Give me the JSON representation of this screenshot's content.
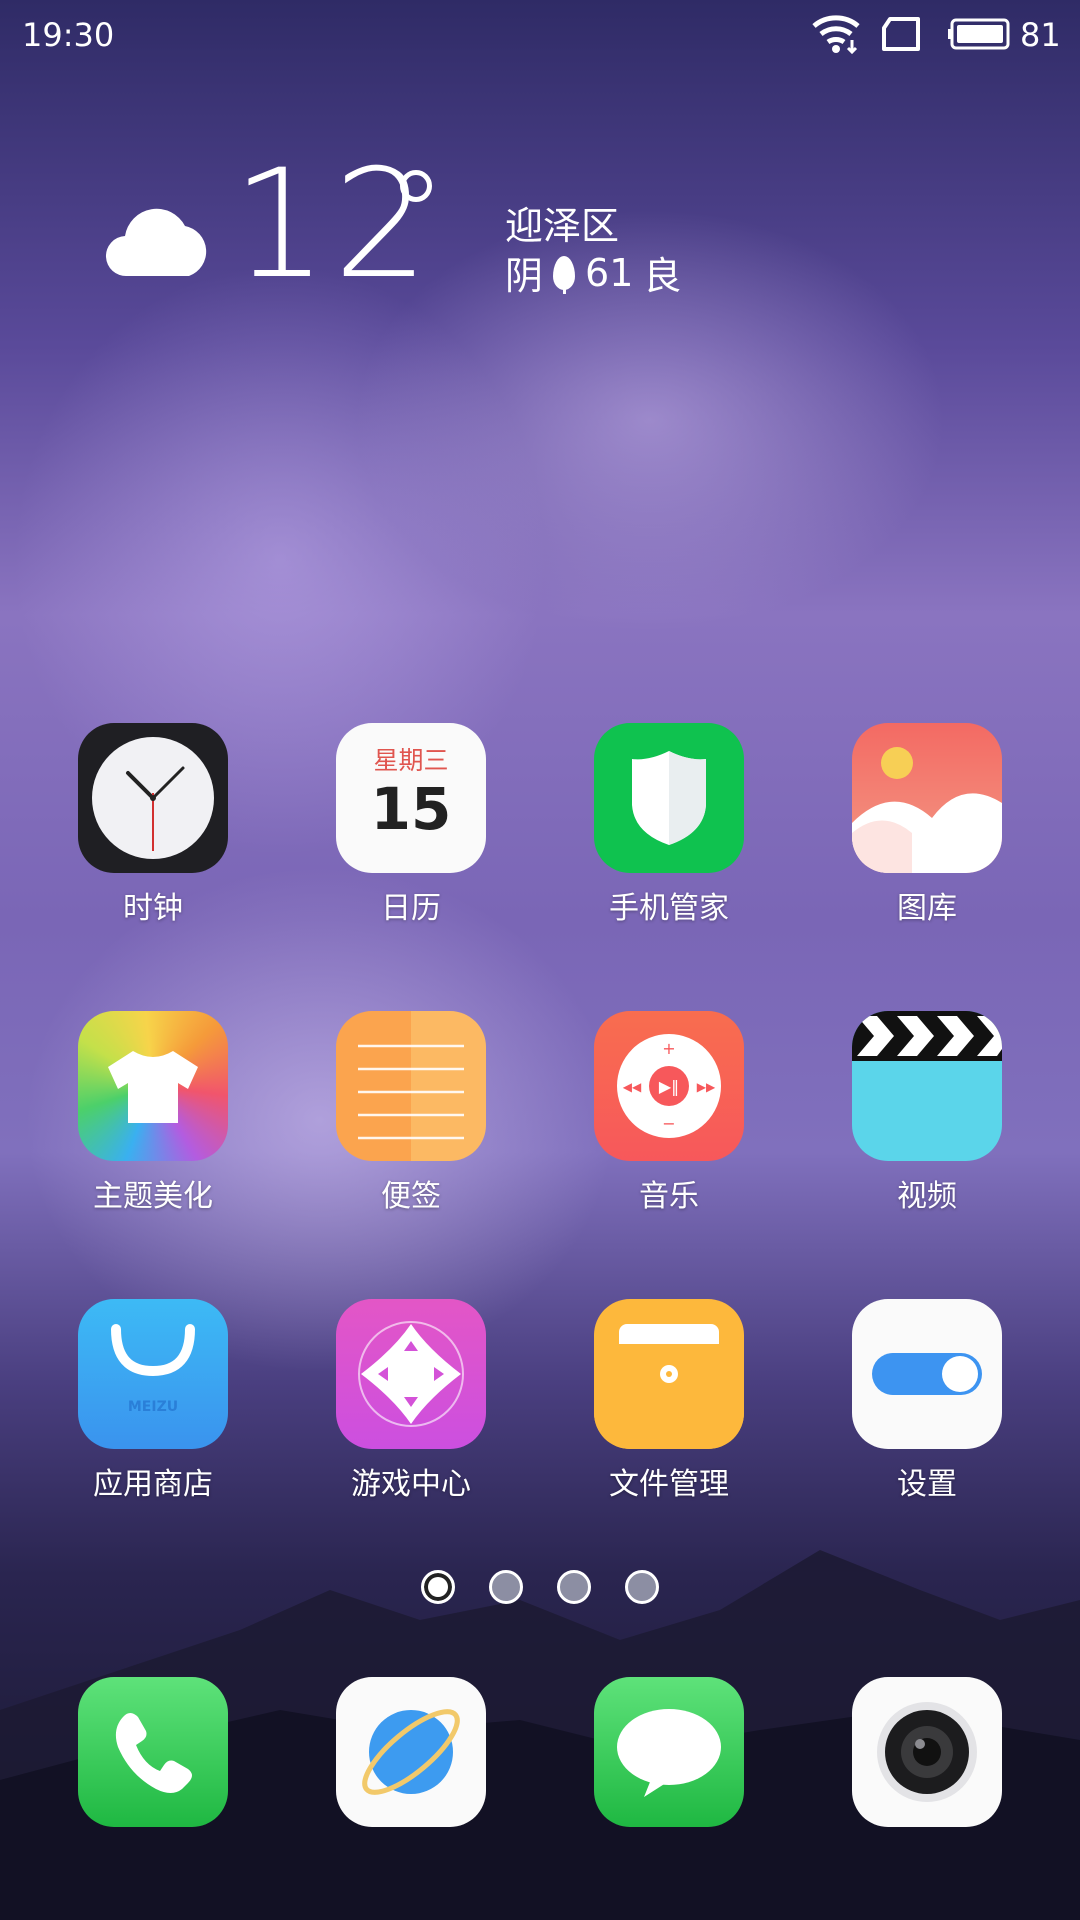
{
  "status_bar": {
    "time": "19:30",
    "battery_level": "81"
  },
  "weather": {
    "temperature": "12",
    "district": "迎泽区",
    "condition": "阴",
    "aqi_value": "61",
    "aqi_level": "良"
  },
  "calendar_icon": {
    "weekday": "星期三",
    "day": "15"
  },
  "apps": [
    {
      "label": "时钟"
    },
    {
      "label": "日历"
    },
    {
      "label": "手机管家"
    },
    {
      "label": "图库"
    },
    {
      "label": "主题美化"
    },
    {
      "label": "便签"
    },
    {
      "label": "音乐"
    },
    {
      "label": "视频"
    },
    {
      "label": "应用商店"
    },
    {
      "label": "游戏中心"
    },
    {
      "label": "文件管理"
    },
    {
      "label": "设置"
    }
  ],
  "app_store_brand": "MEIZU",
  "page_indicator": {
    "pages": 4,
    "active": 1
  },
  "dock": [
    "phone-icon",
    "browser-icon",
    "messages-icon",
    "camera-icon"
  ]
}
